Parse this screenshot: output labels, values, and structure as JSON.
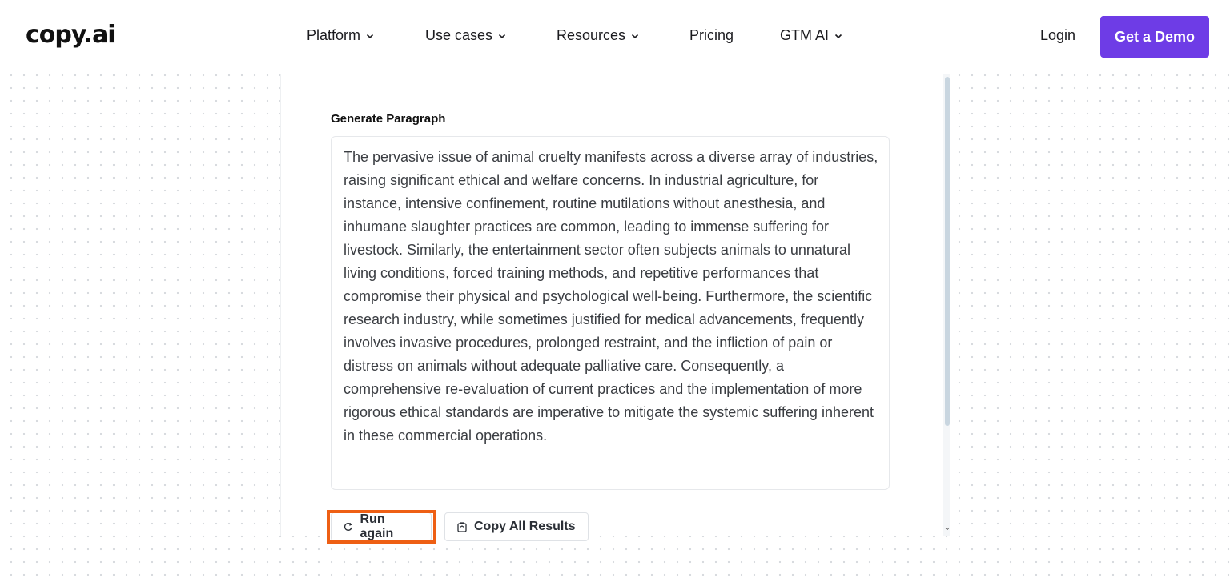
{
  "header": {
    "logo": "copy.ai",
    "nav": [
      {
        "label": "Platform",
        "has_dropdown": true
      },
      {
        "label": "Use cases",
        "has_dropdown": true
      },
      {
        "label": "Resources",
        "has_dropdown": true
      },
      {
        "label": "Pricing",
        "has_dropdown": false
      },
      {
        "label": "GTM AI",
        "has_dropdown": true
      }
    ],
    "login": "Login",
    "cta": "Get a Demo"
  },
  "result": {
    "title": "Generate Paragraph",
    "text": "The pervasive issue of animal cruelty manifests across a diverse array of industries, raising significant ethical and welfare concerns. In industrial agriculture, for instance, intensive confinement, routine mutilations without anesthesia, and inhumane slaughter practices are common, leading to immense suffering for livestock. Similarly, the entertainment sector often subjects animals to unnatural living conditions, forced training methods, and repetitive performances that compromise their physical and psychological well-being. Furthermore, the scientific research industry, while sometimes justified for medical advancements, frequently involves invasive procedures, prolonged restraint, and the infliction of pain or distress on animals without adequate palliative care. Consequently, a comprehensive re-evaluation of current practices and the implementation of more rigorous ethical standards are imperative to mitigate the systemic suffering inherent in these commercial operations."
  },
  "actions": {
    "run_again": "Run again",
    "copy_all": "Copy All Results"
  },
  "colors": {
    "brand": "#6e3ce6",
    "highlight": "#ee5f14"
  },
  "icons": {
    "chevron": "chevron-down-icon",
    "run_again": "refresh-icon",
    "copy": "clipboard-icon"
  }
}
